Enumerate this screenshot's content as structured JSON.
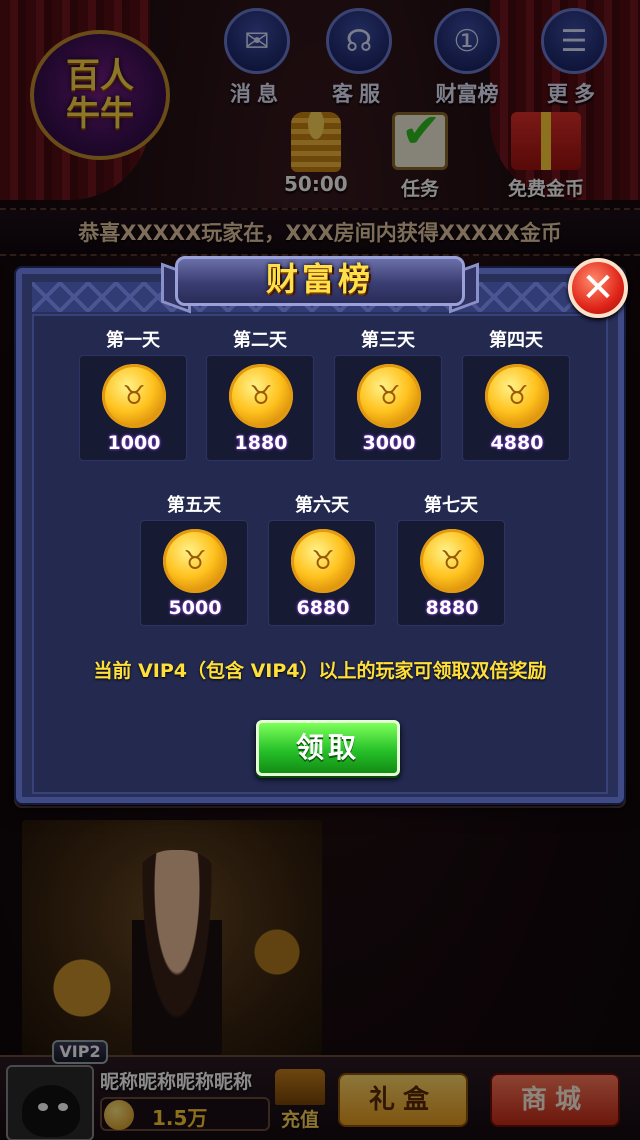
{
  "logo": {
    "line1": "百人",
    "line2": "牛牛"
  },
  "top_icons": [
    {
      "label": "消息",
      "icon": "mail-icon",
      "glyph": "✉"
    },
    {
      "label": "客服",
      "icon": "headset-icon",
      "glyph": "☊"
    },
    {
      "label": "财富榜",
      "icon": "medal-icon",
      "glyph": "①"
    },
    {
      "label": "更多",
      "icon": "menu-icon",
      "glyph": "☰"
    }
  ],
  "timer": "50:00",
  "task_label": "任务",
  "free_coins_label": "免费金币",
  "ticker_text": "恭喜XXXXX玩家在，XXX房间内获得XXXXX金币",
  "dialog": {
    "title": "财富榜",
    "days": [
      {
        "label": "第一天",
        "amount": "1000"
      },
      {
        "label": "第二天",
        "amount": "1880"
      },
      {
        "label": "第三天",
        "amount": "3000"
      },
      {
        "label": "第四天",
        "amount": "4880"
      },
      {
        "label": "第五天",
        "amount": "5000"
      },
      {
        "label": "第六天",
        "amount": "6880"
      },
      {
        "label": "第七天",
        "amount": "8880"
      }
    ],
    "vip_note": "当前 VIP4（包含 VIP4）以上的玩家可领取双倍奖励",
    "claim_label": "领取",
    "close_glyph": "✕"
  },
  "user": {
    "vip": "VIP2",
    "nickname": "昵称昵称昵称昵称",
    "balance": "1.5万"
  },
  "bottom": {
    "recharge_label": "充值",
    "gift_label": "礼盒",
    "shop_label": "商城"
  },
  "colors": {
    "dialog_bg": "#28305a",
    "claim_green": "#27c12a",
    "accent_gold": "#ffe04a",
    "close_red": "#e0251a"
  }
}
